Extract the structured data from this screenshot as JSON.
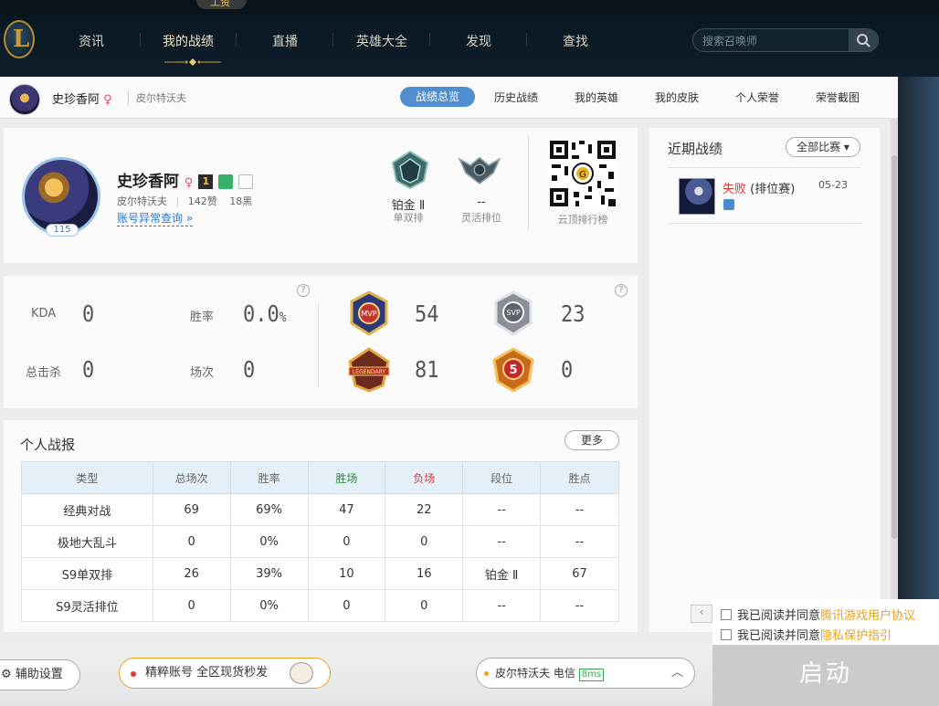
{
  "top_badge": "工资",
  "nav": {
    "items": [
      "资讯",
      "我的战绩",
      "直播",
      "英雄大全",
      "发现",
      "查找"
    ],
    "active_index": 1,
    "search_placeholder": "搜索召唤师"
  },
  "subbar": {
    "name": "史珍香阿",
    "gender_symbol": "♀",
    "server": "皮尔特沃夫",
    "tabs": [
      "战绩总览",
      "历史战绩",
      "我的英雄",
      "我的皮肤",
      "个人荣誉",
      "荣誉截图"
    ],
    "active_tab": 0
  },
  "profile": {
    "name": "史珍香阿",
    "gender_symbol": "♀",
    "level": "115",
    "server": "皮尔特沃夫",
    "likes": "142赞",
    "blacks": "18黑",
    "link": "账号异常查询 »",
    "badge_rank": "1",
    "rank_solo": {
      "label": "铂金 Ⅱ",
      "sub": "单双排"
    },
    "rank_flex": {
      "label": "--",
      "sub": "灵活排位"
    },
    "qr_label": "云顶排行榜"
  },
  "stats": {
    "kda_label": "KDA",
    "kda": "0",
    "winrate_label": "胜率",
    "winrate": "0.0",
    "winrate_unit": "%",
    "kills_label": "总击杀",
    "kills": "0",
    "games_label": "场次",
    "games": "0",
    "help": "?",
    "medals": [
      {
        "name": "MVP",
        "count": "54"
      },
      {
        "name": "SVP",
        "count": "23"
      },
      {
        "name": "LEGENDARY",
        "count": "81"
      },
      {
        "name": "5",
        "count": "0"
      }
    ]
  },
  "report": {
    "title": "个人战报",
    "more": "更多",
    "columns": [
      "类型",
      "总场次",
      "胜率",
      "胜场",
      "负场",
      "段位",
      "胜点"
    ],
    "rows": [
      [
        "经典对战",
        "69",
        "69%",
        "47",
        "22",
        "--",
        "--"
      ],
      [
        "极地大乱斗",
        "0",
        "0%",
        "0",
        "0",
        "--",
        "--"
      ],
      [
        "S9单双排",
        "26",
        "39%",
        "10",
        "16",
        "铂金 Ⅱ",
        "67"
      ],
      [
        "S9灵活排位",
        "0",
        "0%",
        "0",
        "0",
        "--",
        "--"
      ]
    ]
  },
  "recent": {
    "title": "近期战绩",
    "filter": "全部比赛 ▾",
    "matches": [
      {
        "result": "失败",
        "mode": "(排位赛)",
        "date": "05-23"
      }
    ]
  },
  "agreements": [
    {
      "prefix": "我已阅读并同意",
      "link": "腾讯游戏用户协议"
    },
    {
      "prefix": "我已阅读并同意",
      "link": "隐私保护指引"
    }
  ],
  "bottom": {
    "assist": "辅助设置",
    "ad": "精粹账号 全区现货秒发",
    "server": "皮尔特沃夫 电信",
    "ping": "8ms",
    "launch": "启动"
  },
  "colors": {
    "accent_blue": "#4f8fd1",
    "lose_red": "#e23838",
    "win_green": "#2e8b3a",
    "gold": "#c89b3c"
  }
}
